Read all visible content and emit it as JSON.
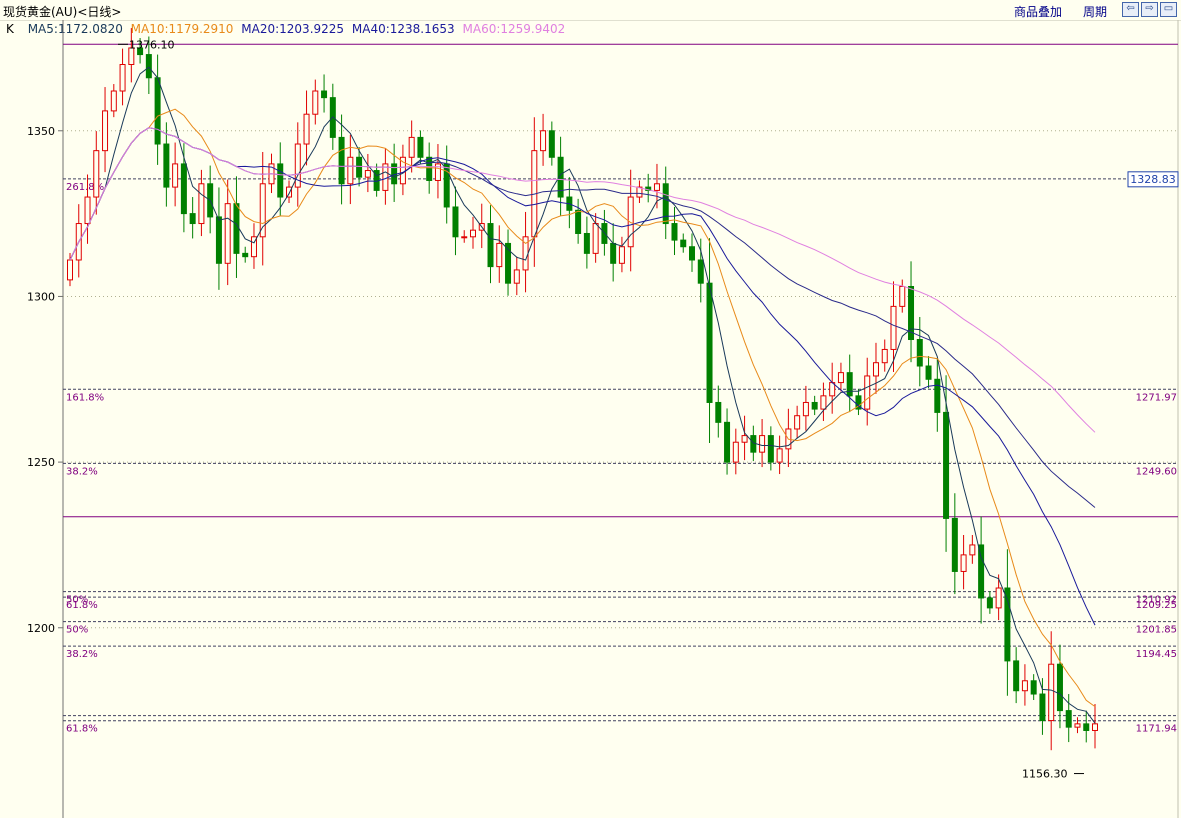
{
  "window_title": "现货黄金(AU)<日线>",
  "top_links": [
    "商品叠加",
    "周期"
  ],
  "nav_icons": [
    "arrow-left-icon",
    "arrow-right-icon",
    "maximize-icon"
  ],
  "legend": {
    "k_label": "K",
    "items": [
      {
        "text": "MA5:1172.0820",
        "color": "#1a3a5a"
      },
      {
        "text": "MA10:1179.2910",
        "color": "#e88a1a"
      },
      {
        "text": "MA20:1203.9225",
        "color": "#1a1a9a"
      },
      {
        "text": "MA40:1238.1653",
        "color": "#1a1a9a"
      },
      {
        "text": "MA60:1259.9402",
        "color": "#e080e0"
      }
    ]
  },
  "colors": {
    "up": "#e00000",
    "down": "#008000",
    "fib": "#800080",
    "grid": "#b0b090",
    "axis": "#707070"
  },
  "chart_data": {
    "type": "candlestick",
    "ylim": [
      1145,
      1378
    ],
    "yticks": [
      1200,
      1250,
      1300,
      1350
    ],
    "price_labels": {
      "high": "1376.10",
      "low": "1156.30",
      "current": "1328.83"
    },
    "fib_levels": [
      {
        "value": 1335.5,
        "left": "261.8%",
        "right": ""
      },
      {
        "value": 1271.97,
        "left": "161.8%",
        "right": "1271.97"
      },
      {
        "value": 1249.6,
        "left": "38.2%",
        "right": "1249.60"
      },
      {
        "value": 1209.25,
        "left": "61.8%",
        "right": "1209.25"
      },
      {
        "value": 1210.9,
        "left": "50%",
        "right": "1210.92"
      },
      {
        "value": 1201.85,
        "left": "50%",
        "right": "1201.85"
      },
      {
        "value": 1194.45,
        "left": "38.2%",
        "right": "1194.45"
      },
      {
        "value": 1171.94,
        "left": "61.8%",
        "right": "1171.94"
      },
      {
        "value": 1173.5,
        "left": "",
        "right": ""
      }
    ],
    "solid_levels": [
      1376.1,
      1233.5
    ],
    "closes": [
      1311,
      1322,
      1330,
      1344,
      1356,
      1362,
      1370,
      1375,
      1373,
      1366,
      1346,
      1333,
      1340,
      1325,
      1322,
      1334,
      1324,
      1310,
      1328,
      1313,
      1312,
      1318,
      1334,
      1340,
      1330,
      1333,
      1346,
      1355,
      1362,
      1360,
      1348,
      1334,
      1342,
      1336,
      1338,
      1332,
      1340,
      1334,
      1342,
      1348,
      1342,
      1335,
      1340,
      1327,
      1318,
      1318,
      1320,
      1322,
      1309,
      1316,
      1304,
      1308,
      1318,
      1344,
      1350,
      1342,
      1330,
      1326,
      1319,
      1313,
      1322,
      1316,
      1310,
      1315,
      1330,
      1333,
      1332,
      1334,
      1322,
      1317,
      1315,
      1311,
      1304,
      1268,
      1262,
      1250,
      1256,
      1258,
      1253,
      1258,
      1250,
      1254,
      1260,
      1264,
      1268,
      1266,
      1270,
      1274,
      1277,
      1270,
      1266,
      1276,
      1280,
      1284,
      1297,
      1303,
      1287,
      1279,
      1275,
      1265,
      1233,
      1217,
      1222,
      1225,
      1209,
      1206,
      1212,
      1190,
      1181,
      1184,
      1180,
      1172,
      1189,
      1175,
      1170,
      1171,
      1169,
      1171
    ]
  }
}
